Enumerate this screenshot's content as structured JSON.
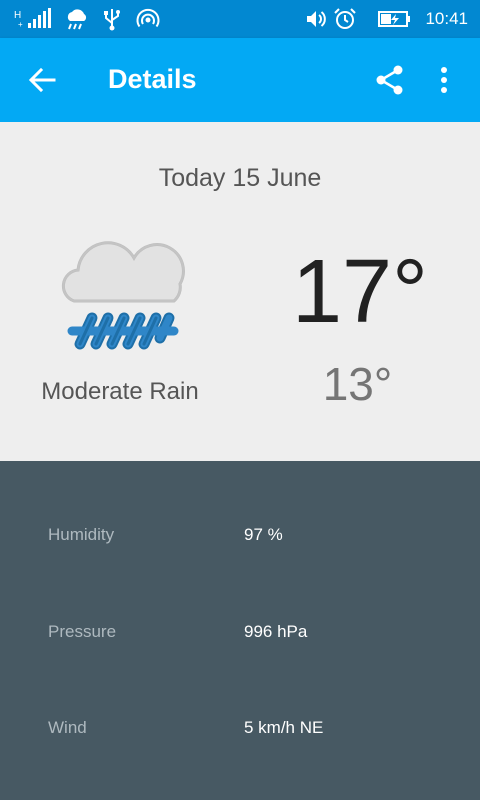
{
  "status_bar": {
    "time": "10:41",
    "icons": [
      "signal-icon",
      "weather-notification-icon",
      "usb-icon",
      "hotspot-icon",
      "volume-icon",
      "alarm-icon",
      "battery-charging-icon"
    ]
  },
  "app_bar": {
    "title": "Details",
    "back_icon": "arrow-back-icon",
    "share_icon": "share-icon",
    "more_icon": "more-vert-icon"
  },
  "summary": {
    "date": "Today 15 June",
    "condition": "Moderate Rain",
    "condition_icon": "rain-cloud-icon",
    "temp_high": "17°",
    "temp_low": "13°"
  },
  "details": [
    {
      "label": "Humidity",
      "value": "97 %"
    },
    {
      "label": "Pressure",
      "value": "996 hPa"
    },
    {
      "label": "Wind",
      "value": "5 km/h NE"
    }
  ],
  "colors": {
    "status_bar": "#0288D1",
    "app_bar": "#03A9F4",
    "details_bg": "#475963",
    "summary_bg": "#EEEEEE",
    "rain": "#2F86C8"
  }
}
